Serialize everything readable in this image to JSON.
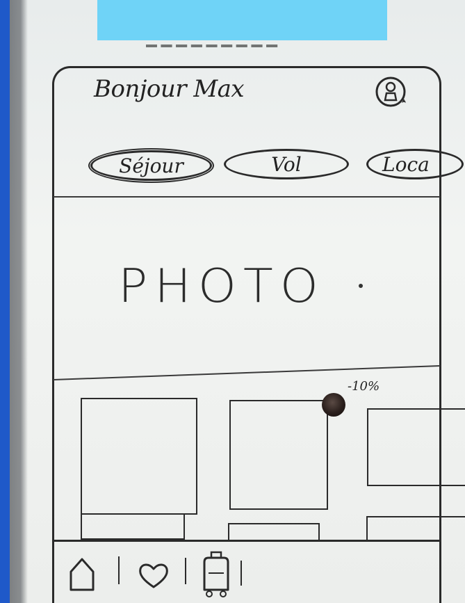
{
  "header": {
    "greeting": "Bonjour Max"
  },
  "categories": [
    {
      "label": "Séjour",
      "selected": true
    },
    {
      "label": "Vol",
      "selected": false
    },
    {
      "label": "Loca",
      "selected": false
    }
  ],
  "hero": {
    "label": "PHOTO"
  },
  "offers": {
    "badge": "-10%"
  },
  "tabbar": {
    "items": [
      "home-icon",
      "heart-icon",
      "luggage-icon"
    ]
  }
}
